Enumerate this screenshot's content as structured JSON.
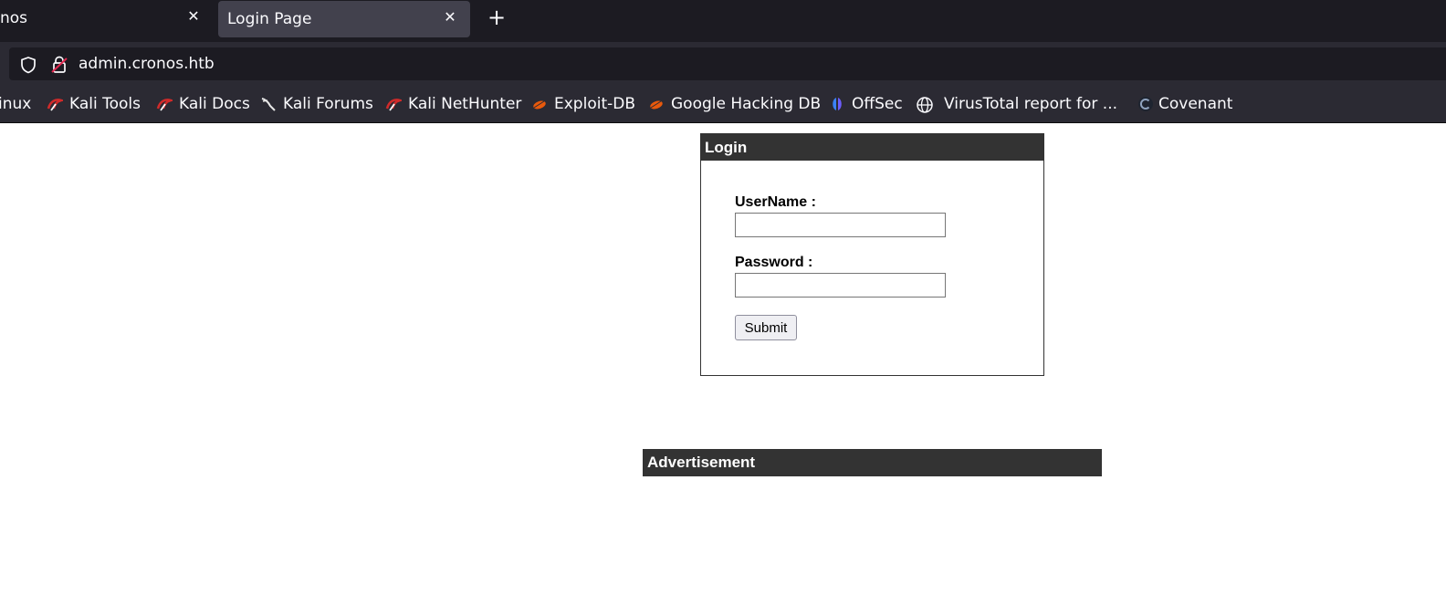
{
  "tabs": [
    {
      "label": "nos",
      "active": false
    },
    {
      "label": "Login Page",
      "active": true
    }
  ],
  "tab_close_glyph": "✕",
  "new_tab_glyph": "+",
  "url": "admin.cronos.htb",
  "bookmarks": [
    {
      "label": "inux",
      "icon": "none"
    },
    {
      "label": "Kali Tools",
      "icon": "kali-dragon-icon"
    },
    {
      "label": "Kali Docs",
      "icon": "kali-dragon-icon"
    },
    {
      "label": "Kali Forums",
      "icon": "kali-forums-icon"
    },
    {
      "label": "Kali NetHunter",
      "icon": "kali-dragon-icon"
    },
    {
      "label": "Exploit-DB",
      "icon": "exploit-db-icon"
    },
    {
      "label": "Google Hacking DB",
      "icon": "exploit-db-icon"
    },
    {
      "label": "OffSec",
      "icon": "offsec-icon"
    },
    {
      "label": "VirusTotal report for ...",
      "icon": "globe-icon"
    },
    {
      "label": "Covenant",
      "icon": "covenant-icon"
    }
  ],
  "login": {
    "title": "Login",
    "username_label": "UserName :",
    "username_value": "",
    "password_label": "Password :",
    "password_value": "",
    "submit_label": "Submit"
  },
  "advertisement": {
    "title": "Advertisement"
  },
  "colors": {
    "tabbar_bg": "#1c1b22",
    "toolbar_bg": "#2b2a33",
    "box_header_bg": "#333333",
    "kali_red": "#d02a2a",
    "exploit_orange": "#e8590c"
  }
}
